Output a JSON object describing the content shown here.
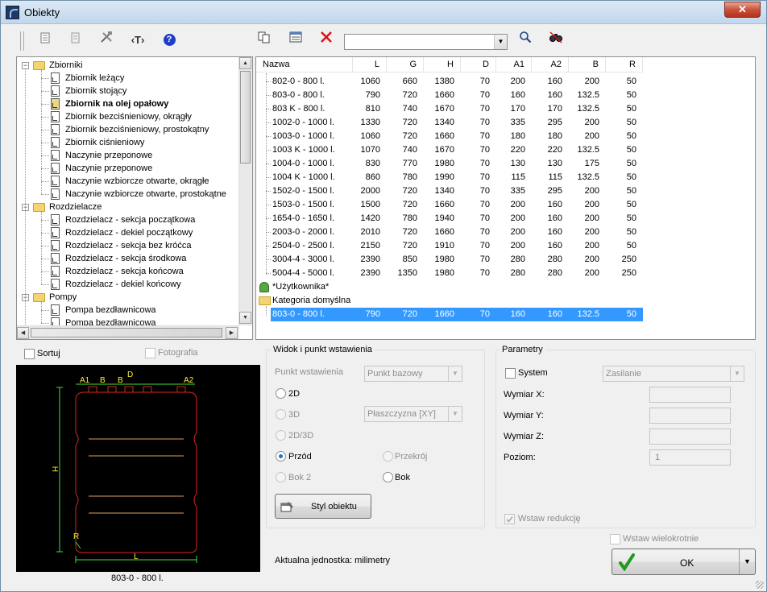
{
  "window": {
    "title": "Obiekty",
    "close_glyph": "✕"
  },
  "toolbar": {
    "text_tool_label": "‹T›",
    "help_label": "?",
    "search_value": "",
    "combo_arrow": "▼"
  },
  "tree": {
    "groups": [
      {
        "label": "Zbiorniki",
        "items": [
          "Zbiornik leżący",
          "Zbiornik stojący",
          "Zbiornik na olej opałowy",
          "Zbiornik bezciśnieniowy, okrągły",
          "Zbiornik bezciśnieniowy, prostokątny",
          "Zbiornik ciśnieniowy",
          "Naczynie przeponowe",
          "Naczynie przeponowe",
          "Naczynie wzbiorcze otwarte, okrągłe",
          "Naczynie wzbiorcze otwarte, prostokątne"
        ]
      },
      {
        "label": "Rozdzielacze",
        "items": [
          "Rozdzielacz - sekcja początkowa",
          "Rozdzielacz - dekiel początkowy",
          "Rozdzielacz - sekcja bez króćca",
          "Rozdzielacz - sekcja środkowa",
          "Rozdzielacz - sekcja końcowa",
          "Rozdzielacz - dekiel końcowy"
        ]
      },
      {
        "label": "Pompy",
        "items": [
          "Pompa bezdławnicowa",
          "Pompa bezdławnicowa"
        ]
      }
    ],
    "selected_item": "Zbiornik na olej opałowy"
  },
  "list": {
    "columns": [
      "Nazwa",
      "L",
      "G",
      "H",
      "D",
      "A1",
      "A2",
      "B",
      "R"
    ],
    "rows": [
      [
        "802-0 - 800 l.",
        "1060",
        "660",
        "1380",
        "70",
        "200",
        "160",
        "200",
        "50"
      ],
      [
        "803-0 - 800 l.",
        "790",
        "720",
        "1660",
        "70",
        "160",
        "160",
        "132.5",
        "50"
      ],
      [
        "803 K - 800 l.",
        "810",
        "740",
        "1670",
        "70",
        "170",
        "170",
        "132.5",
        "50"
      ],
      [
        "1002-0 - 1000 l.",
        "1330",
        "720",
        "1340",
        "70",
        "335",
        "295",
        "200",
        "50"
      ],
      [
        "1003-0 - 1000 l.",
        "1060",
        "720",
        "1660",
        "70",
        "180",
        "180",
        "200",
        "50"
      ],
      [
        "1003 K - 1000 l.",
        "1070",
        "740",
        "1670",
        "70",
        "220",
        "220",
        "132.5",
        "50"
      ],
      [
        "1004-0 - 1000 l.",
        "830",
        "770",
        "1980",
        "70",
        "130",
        "130",
        "175",
        "50"
      ],
      [
        "1004 K - 1000 l.",
        "860",
        "780",
        "1990",
        "70",
        "115",
        "115",
        "132.5",
        "50"
      ],
      [
        "1502-0 - 1500 l.",
        "2000",
        "720",
        "1340",
        "70",
        "335",
        "295",
        "200",
        "50"
      ],
      [
        "1503-0 - 1500 l.",
        "1500",
        "720",
        "1660",
        "70",
        "200",
        "160",
        "200",
        "50"
      ],
      [
        "1654-0 - 1650 l.",
        "1420",
        "780",
        "1940",
        "70",
        "200",
        "160",
        "200",
        "50"
      ],
      [
        "2003-0 - 2000 l.",
        "2010",
        "720",
        "1660",
        "70",
        "200",
        "160",
        "200",
        "50"
      ],
      [
        "2504-0 - 2500 l.",
        "2150",
        "720",
        "1910",
        "70",
        "200",
        "160",
        "200",
        "50"
      ],
      [
        "3004-4 - 3000 l.",
        "2390",
        "850",
        "1980",
        "70",
        "280",
        "280",
        "200",
        "250"
      ],
      [
        "5004-4 - 5000 l.",
        "2390",
        "1350",
        "1980",
        "70",
        "280",
        "280",
        "200",
        "250"
      ]
    ],
    "user_node": "*Użytkownika*",
    "default_node": "Kategoria domyślna",
    "selected_row": [
      "803-0 - 800 l.",
      "790",
      "720",
      "1660",
      "70",
      "160",
      "160",
      "132.5",
      "50"
    ]
  },
  "options": {
    "sort_label": "Sortuj",
    "photo_label": "Fotografia"
  },
  "preview": {
    "caption": "803-0 - 800 l.",
    "labels": {
      "a1": "A1",
      "b1": "B",
      "b2": "B",
      "d": "D",
      "a2": "A2",
      "h": "H",
      "r": "R",
      "l": "L"
    }
  },
  "view_group": {
    "title": "Widok i punkt wstawienia",
    "insert_point_label": "Punkt wstawienia",
    "insert_point_value": "Punkt bazowy",
    "plane_value": "Płaszczyzna  [XY]",
    "radio_2d": "2D",
    "radio_3d": "3D",
    "radio_2d3d": "2D/3D",
    "radio_front": "Przód",
    "radio_section": "Przekrój",
    "radio_side2": "Bok 2",
    "radio_side": "Bok",
    "style_button": "Styl obiektu",
    "unit_text": "Aktualna jednostka: milimetry"
  },
  "params_group": {
    "title": "Parametry",
    "system_label": "System",
    "system_value": "Zasilanie",
    "x_label": "Wymiar X:",
    "y_label": "Wymiar Y:",
    "z_label": "Wymiar Z:",
    "level_label": "Poziom:",
    "level_value": "1",
    "reduction_label": "Wstaw redukcję"
  },
  "footer": {
    "multi_insert_label": "Wstaw wielokrotnie",
    "ok_label": "OK",
    "ok_arrow": "▼"
  }
}
